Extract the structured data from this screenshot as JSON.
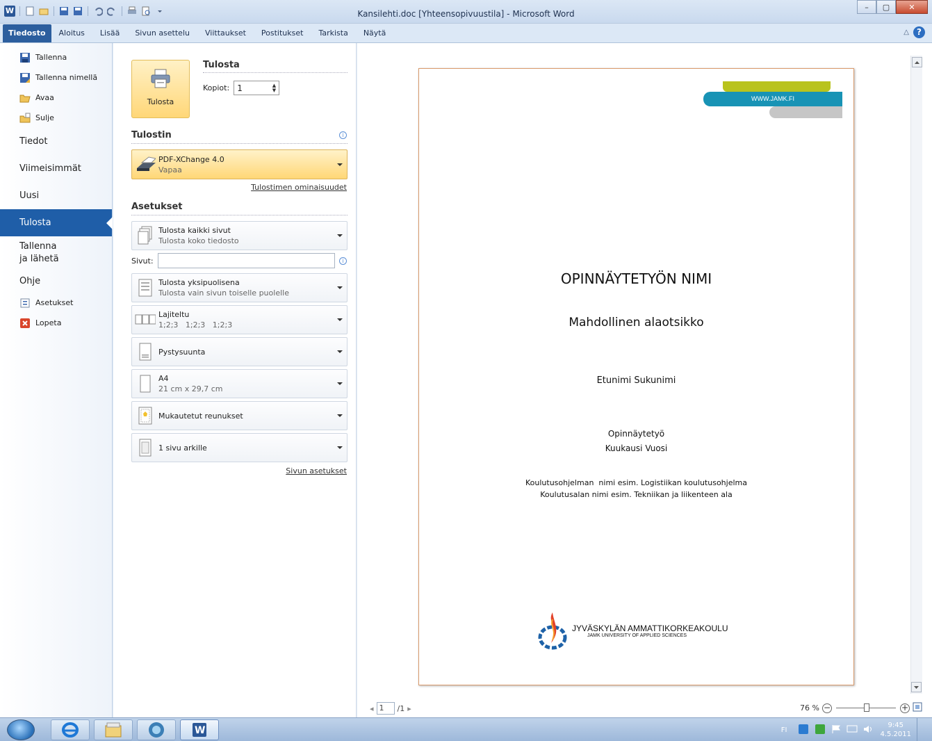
{
  "window": {
    "title": "Kansilehti.doc [Yhteensopivuustila] - Microsoft Word"
  },
  "ribbon": {
    "tabs": [
      "Tiedosto",
      "Aloitus",
      "Lisää",
      "Sivun asettelu",
      "Viittaukset",
      "Postitukset",
      "Tarkista",
      "Näytä"
    ]
  },
  "leftnav": {
    "commands": [
      {
        "label": "Tallenna",
        "icon": "save-icon"
      },
      {
        "label": "Tallenna nimellä",
        "icon": "save-as-icon"
      },
      {
        "label": "Avaa",
        "icon": "open-folder-icon"
      },
      {
        "label": "Sulje",
        "icon": "close-folder-icon"
      }
    ],
    "items": [
      "Tiedot",
      "Viimeisimmät",
      "Uusi",
      "Tulosta",
      "Tallenna\nja lähetä",
      "Ohje"
    ],
    "bottom_commands": [
      {
        "label": "Asetukset",
        "icon": "options-icon"
      },
      {
        "label": "Lopeta",
        "icon": "exit-icon"
      }
    ],
    "active": "Tulosta"
  },
  "print": {
    "heading": "Tulosta",
    "button_label": "Tulosta",
    "copies_label": "Kopiot:",
    "copies_value": "1",
    "printer_heading": "Tulostin",
    "printer_name": "PDF-XChange 4.0",
    "printer_status": "Vapaa",
    "printer_properties_link": "Tulostimen ominaisuudet",
    "settings_heading": "Asetukset",
    "pages_label": "Sivut:",
    "pages_value": "",
    "settings": [
      {
        "t1": "Tulosta kaikki sivut",
        "t2": "Tulosta koko tiedosto",
        "icon": "all-pages-icon"
      },
      {
        "t1": "Tulosta yksipuolisena",
        "t2": "Tulosta vain sivun toiselle puolelle",
        "icon": "one-sided-icon"
      },
      {
        "t1": "Lajiteltu",
        "t2": "1;2;3   1;2;3   1;2;3",
        "icon": "collated-icon"
      },
      {
        "t1": "Pystysuunta",
        "t2": "",
        "icon": "portrait-icon"
      },
      {
        "t1": "A4",
        "t2": "21 cm x 29,7 cm",
        "icon": "paper-size-icon"
      },
      {
        "t1": "Mukautetut reunukset",
        "t2": "",
        "icon": "margins-icon"
      },
      {
        "t1": "1 sivu arkille",
        "t2": "",
        "icon": "pages-per-sheet-icon"
      }
    ],
    "page_setup_link": "Sivun asetukset"
  },
  "preview": {
    "header_url": "WWW.JAMK.FI",
    "title": "OPINNÄYTETYÖN NIMI",
    "subtitle": "Mahdollinen alaotsikko",
    "author": "Etunimi Sukunimi",
    "type": "Opinnäytetyö",
    "date": "Kuukausi Vuosi",
    "program": "Koulutusohjelman  nimi esim. Logistiikan koulutusohjelma",
    "field": "Koulutusalan nimi esim. Tekniikan ja liikenteen ala",
    "logo_name": "JYVÄSKYLÄN AMMATTIKORKEAKOULU",
    "logo_sub": "JAMK UNIVERSITY OF APPLIED SCIENCES",
    "current_page": "1",
    "total_pages": "/1",
    "zoom": "76 %"
  },
  "taskbar": {
    "language": "FI",
    "time": "9:45",
    "date": "4.5.2011"
  }
}
